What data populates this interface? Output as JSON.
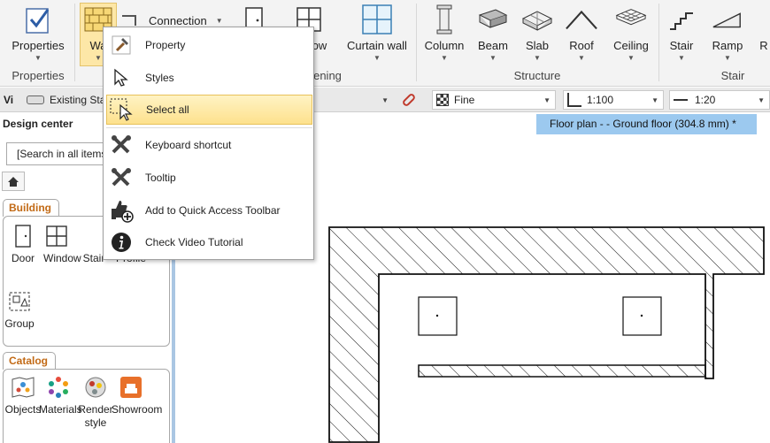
{
  "ribbon": {
    "properties_label": "Properties",
    "wall_label": "Wa",
    "connection_label": "Connection",
    "window_label": "ow",
    "curtain_wall_label": "Curtain wall",
    "column_label": "Column",
    "beam_label": "Beam",
    "slab_label": "Slab",
    "roof_label": "Roof",
    "ceiling_label": "Ceiling",
    "stair_label": "Stair",
    "ramp_label": "Ramp",
    "r_label": "R",
    "groups": {
      "properties": "Properties",
      "opening": "ening",
      "structure": "Structure",
      "stair": "Stair"
    }
  },
  "toolbar2": {
    "view_label": "Vi",
    "existing_label": "Existing Sta",
    "fine_label": "Fine",
    "scale1": "1:100",
    "scale2": "1:20"
  },
  "design_center": {
    "title": "Design center",
    "search_value": "[Search in all items]",
    "building": {
      "tab": "Building",
      "items": [
        "Door",
        "Window",
        "Stair",
        "Profile",
        "Group"
      ]
    },
    "catalog": {
      "tab": "Catalog",
      "items": [
        "Objects",
        "Materials",
        "Render style",
        "Showroom"
      ]
    }
  },
  "floor_tab": {
    "label": "Floor plan -   - Ground floor (304.8 mm) *"
  },
  "menu": {
    "items": [
      "Property",
      "Styles",
      "Select all",
      "Keyboard shortcut",
      "Tooltip",
      "Add to Quick Access Toolbar",
      "Check Video Tutorial"
    ]
  },
  "colors": {
    "accent_blue": "#9cc9ef",
    "catalog_orange": "#c26a16",
    "highlight": "#fde18d"
  }
}
